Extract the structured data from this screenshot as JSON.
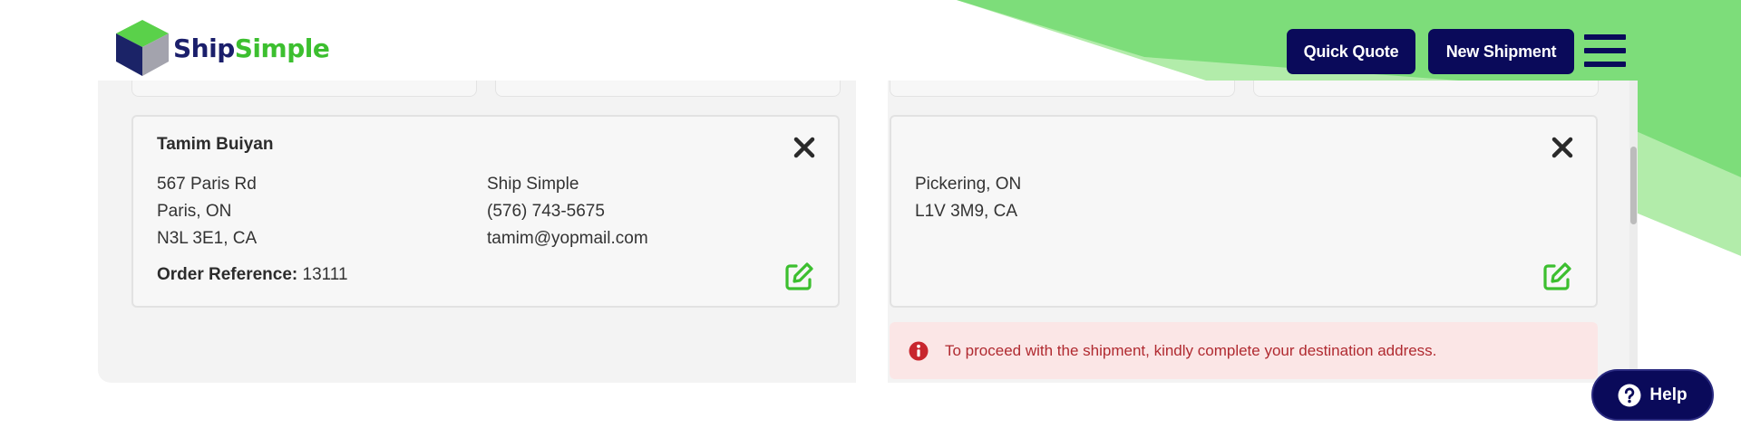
{
  "brand": {
    "ship": "Ship",
    "simple": "Simple"
  },
  "header": {
    "quick_quote": "Quick Quote",
    "new_shipment": "New Shipment"
  },
  "origin": {
    "name": "Tamim Buiyan",
    "address": [
      "567 Paris Rd",
      "Paris, ON",
      "N3L 3E1, CA"
    ],
    "contact": [
      "Ship Simple",
      "(576) 743-5675",
      "tamim@yopmail.com"
    ],
    "order_ref_label": "Order Reference:",
    "order_ref_value": "13111"
  },
  "destination": {
    "address": [
      "Pickering, ON",
      "L1V 3M9, CA"
    ]
  },
  "alert": {
    "message": "To proceed with the shipment, kindly complete your destination address."
  },
  "help": {
    "label": "Help"
  },
  "colors": {
    "navy": "#0a0a5a",
    "green": "#3cbf2f",
    "alert_bg": "#fbe6e6",
    "alert_text": "#b02a30"
  },
  "icons": [
    "logo-cube-icon",
    "hamburger-icon",
    "close-icon",
    "edit-icon",
    "info-icon",
    "question-circle-icon"
  ]
}
